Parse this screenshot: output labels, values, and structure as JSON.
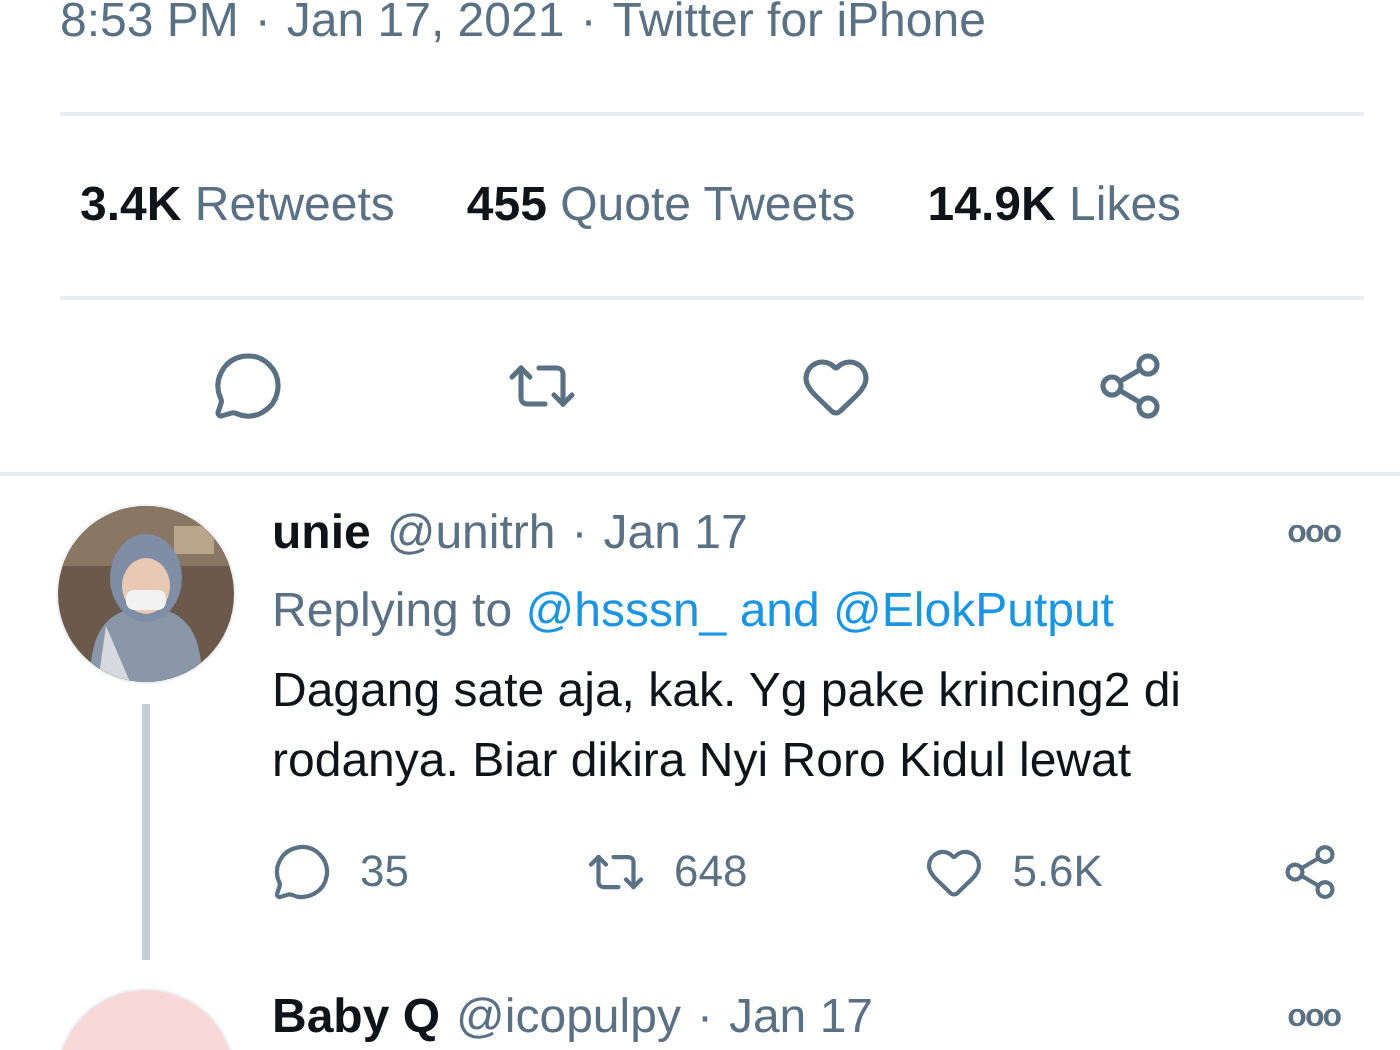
{
  "tweet": {
    "meta": {
      "items": [
        "8:53 PM",
        "Jan 17, 2021",
        "Twitter for iPhone"
      ],
      "separator": "·"
    },
    "stats": [
      {
        "count": "3.4K",
        "label": "Retweets"
      },
      {
        "count": "455",
        "label": "Quote Tweets"
      },
      {
        "count": "14.9K",
        "label": "Likes"
      }
    ],
    "actions": [
      {
        "kind": "reply"
      },
      {
        "kind": "retweet"
      },
      {
        "kind": "like"
      },
      {
        "kind": "share"
      }
    ]
  },
  "replies": [
    {
      "name": "unie",
      "handle": "@unitrh",
      "separator": "·",
      "date": "Jan 17",
      "more": "ooo",
      "thread_line": true,
      "replying_to": {
        "prefix": "Replying to",
        "link": "@hsssn_ and @ElokPutput"
      },
      "text": "Dagang sate aja, kak. Yg pake krincing2 di rodanya. Biar dikira Nyi Roro Kidul lewat",
      "actions": [
        {
          "kind": "reply",
          "count": "35"
        },
        {
          "kind": "retweet",
          "count": "648"
        },
        {
          "kind": "like",
          "count": "5.6K"
        },
        {
          "kind": "share"
        }
      ]
    },
    {
      "avatar": {
        "kind": "plain",
        "color": "#f7d9d9"
      },
      "name": "Baby Q",
      "handle": "@icopulpy",
      "separator": "·",
      "date": "Jan 17",
      "more": "ooo",
      "thread_line": false
    }
  ]
}
